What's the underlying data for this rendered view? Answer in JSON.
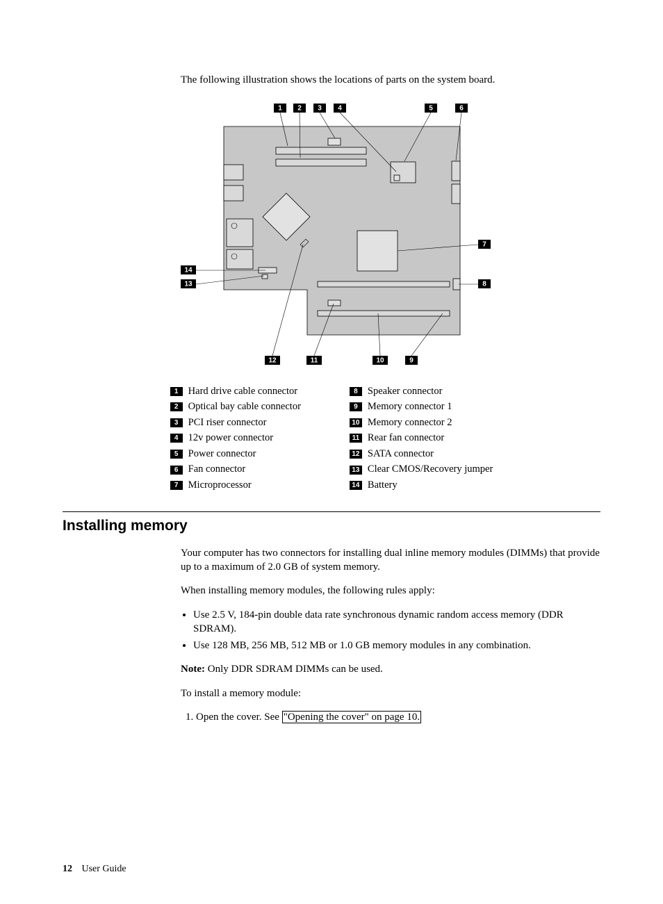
{
  "intro": "The following illustration shows the locations of parts on the system board.",
  "callouts": {
    "n1": "1",
    "n2": "2",
    "n3": "3",
    "n4": "4",
    "n5": "5",
    "n6": "6",
    "n7": "7",
    "n8": "8",
    "n9": "9",
    "n10": "10",
    "n11": "11",
    "n12": "12",
    "n13": "13",
    "n14": "14"
  },
  "legend_left": [
    {
      "n": "1",
      "label": "Hard drive cable connector"
    },
    {
      "n": "2",
      "label": "Optical bay cable connector"
    },
    {
      "n": "3",
      "label": "PCI riser connector"
    },
    {
      "n": "4",
      "label": "12v power connector"
    },
    {
      "n": "5",
      "label": "Power connector"
    },
    {
      "n": "6",
      "label": "Fan connector"
    },
    {
      "n": "7",
      "label": "Microprocessor"
    }
  ],
  "legend_right": [
    {
      "n": "8",
      "label": "Speaker connector"
    },
    {
      "n": "9",
      "label": "Memory connector 1"
    },
    {
      "n": "10",
      "label": "Memory connector 2"
    },
    {
      "n": "11",
      "label": "Rear fan connector"
    },
    {
      "n": "12",
      "label": "SATA connector"
    },
    {
      "n": "13",
      "label": "Clear CMOS/Recovery jumper"
    },
    {
      "n": "14",
      "label": "Battery"
    }
  ],
  "heading": "Installing memory",
  "body": {
    "p1": "Your computer has two connectors for installing dual inline memory modules (DIMMs) that provide up to a maximum of 2.0 GB of system memory.",
    "p2": "When installing memory modules, the following rules apply:",
    "b1": "Use 2.5 V, 184-pin double data rate synchronous dynamic random access memory (DDR SDRAM).",
    "b2": "Use 128 MB, 256 MB, 512 MB or 1.0 GB memory modules in any combination.",
    "note_label": "Note:",
    "note_text": " Only DDR SDRAM DIMMs can be used.",
    "p3": "To install a memory module:",
    "step1_pre": "Open the cover. See ",
    "step1_link": "\"Opening the cover\" on page 10."
  },
  "footer": {
    "page": "12",
    "book": "User Guide"
  }
}
